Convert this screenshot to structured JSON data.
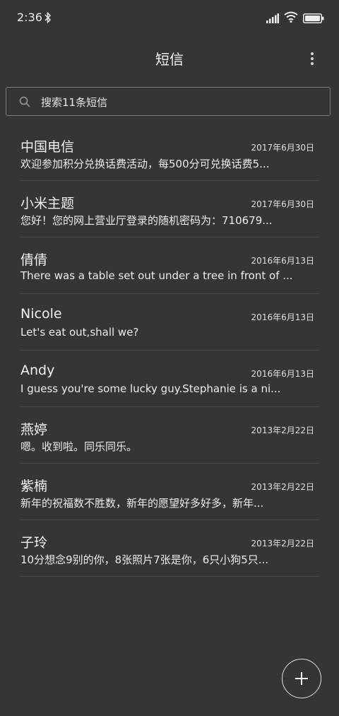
{
  "status_bar": {
    "time": "2:36",
    "icons": [
      "bluetooth-icon",
      "signal-icon",
      "wifi-icon",
      "battery-icon"
    ]
  },
  "header": {
    "title": "短信",
    "menu_icon": "more-vertical-icon"
  },
  "search": {
    "placeholder": "搜索11条短信",
    "icon": "search-icon"
  },
  "conversations": [
    {
      "name": "中国电信",
      "date": "2017年6月30日",
      "preview": "欢迎参加积分兑换话费活动，每500分可兑换话费5..."
    },
    {
      "name": "小米主题",
      "date": "2017年6月30日",
      "preview": "您好！您的网上营业厅登录的随机密码为：710679..."
    },
    {
      "name": "倩倩",
      "date": "2016年6月13日",
      "preview": "There was a table set out under a tree in front of ..."
    },
    {
      "name": "Nicole",
      "date": "2016年6月13日",
      "preview": "Let's eat out,shall we?"
    },
    {
      "name": "Andy",
      "date": "2016年6月13日",
      "preview": "I guess you're some lucky guy.Stephanie is a ni..."
    },
    {
      "name": "燕婷",
      "date": "2013年2月22日",
      "preview": "嗯。收到啦。同乐同乐。"
    },
    {
      "name": "紫楠",
      "date": "2013年2月22日",
      "preview": "新年的祝福数不胜数，新年的愿望好多好多，新年..."
    },
    {
      "name": "子玲",
      "date": "2013年2月22日",
      "preview": "10分想念9别的你，8张照片7张是你，6只小狗5只..."
    }
  ],
  "fab": {
    "icon": "plus-icon"
  },
  "colors": {
    "background": "#353535",
    "text": "#f2f2f2",
    "divider": "#4a4a4a"
  }
}
